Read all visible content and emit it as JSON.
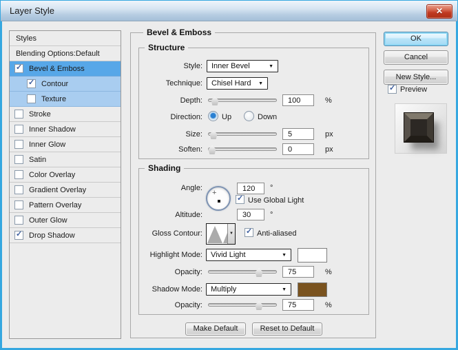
{
  "window": {
    "title": "Layer Style"
  },
  "icons": {
    "close": "✕",
    "check": "✓",
    "dropdown_arrow": "▼",
    "contour_arrow": "▼",
    "dial_crosshair": "+"
  },
  "sidebar": {
    "header": "Styles",
    "items": [
      {
        "label": "Blending Options:Default",
        "has_checkbox": false,
        "checked": false
      },
      {
        "label": "Bevel & Emboss",
        "has_checkbox": true,
        "checked": true,
        "selected": true
      },
      {
        "label": "Contour",
        "has_checkbox": true,
        "checked": true,
        "indented": true
      },
      {
        "label": "Texture",
        "has_checkbox": true,
        "checked": false,
        "indented": true
      },
      {
        "label": "Stroke",
        "has_checkbox": true,
        "checked": false
      },
      {
        "label": "Inner Shadow",
        "has_checkbox": true,
        "checked": false
      },
      {
        "label": "Inner Glow",
        "has_checkbox": true,
        "checked": false
      },
      {
        "label": "Satin",
        "has_checkbox": true,
        "checked": false
      },
      {
        "label": "Color Overlay",
        "has_checkbox": true,
        "checked": false
      },
      {
        "label": "Gradient Overlay",
        "has_checkbox": true,
        "checked": false
      },
      {
        "label": "Pattern Overlay",
        "has_checkbox": true,
        "checked": false
      },
      {
        "label": "Outer Glow",
        "has_checkbox": true,
        "checked": false
      },
      {
        "label": "Drop Shadow",
        "has_checkbox": true,
        "checked": true
      }
    ]
  },
  "panel": {
    "title": "Bevel & Emboss",
    "structure": {
      "legend": "Structure",
      "style_label": "Style:",
      "style_value": "Inner Bevel",
      "technique_label": "Technique:",
      "technique_value": "Chisel Hard",
      "depth_label": "Depth:",
      "depth_value": "100",
      "depth_unit": "%",
      "direction_label": "Direction:",
      "up_label": "Up",
      "down_label": "Down",
      "direction_selected": "Up",
      "size_label": "Size:",
      "size_value": "5",
      "size_unit": "px",
      "soften_label": "Soften:",
      "soften_value": "0",
      "soften_unit": "px"
    },
    "shading": {
      "legend": "Shading",
      "angle_label": "Angle:",
      "angle_value": "120",
      "angle_unit": "°",
      "use_global_light_label": "Use Global Light",
      "use_global_light_checked": true,
      "altitude_label": "Altitude:",
      "altitude_value": "30",
      "altitude_unit": "°",
      "gloss_contour_label": "Gloss Contour:",
      "gloss_contour_name": "cone-contour",
      "anti_aliased_label": "Anti-aliased",
      "anti_aliased_checked": true,
      "highlight_mode_label": "Highlight Mode:",
      "highlight_mode_value": "Vivid Light",
      "highlight_color": "#ffffff",
      "opacity_highlight_label": "Opacity:",
      "opacity_highlight_value": "75",
      "opacity_unit": "%",
      "shadow_mode_label": "Shadow Mode:",
      "shadow_mode_value": "Multiply",
      "shadow_color": "#7a531f",
      "opacity_shadow_label": "Opacity:",
      "opacity_shadow_value": "75"
    },
    "footer_buttons": {
      "make_default": "Make Default",
      "reset_to_default": "Reset to Default"
    }
  },
  "actions": {
    "ok": "OK",
    "cancel": "Cancel",
    "new_style": "New Style...",
    "preview": "Preview",
    "preview_checked": true
  },
  "colors": {
    "selection_blue": "#57a7e8",
    "sub_selection_blue": "#a9cdf0",
    "titlebar_top": "#eef5fb",
    "titlebar_bottom": "#a5bfd8",
    "frame_cyan": "#35a7e0",
    "close_red": "#c03a22",
    "dialog_bg": "#ececec"
  }
}
